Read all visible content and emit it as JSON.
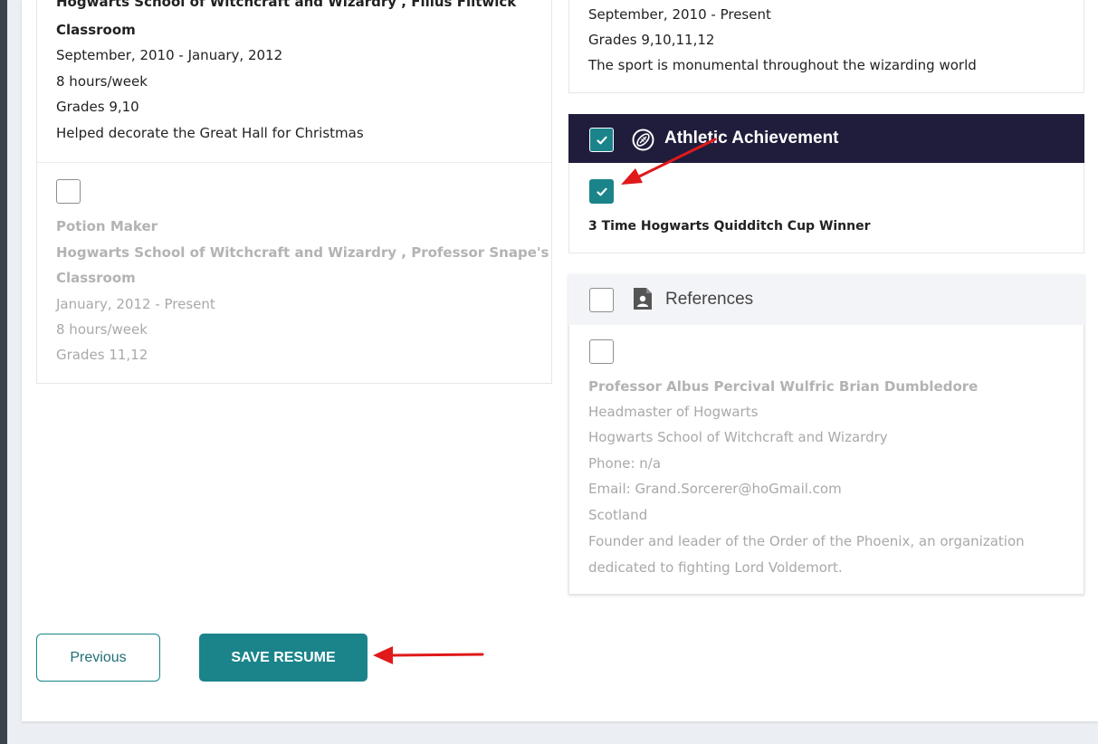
{
  "left_column": {
    "entry1": {
      "org_partial": "Hogwarts School of Witchcraft and Wizardry , Filius Flitwick",
      "org_line2": "Classroom",
      "dates": "September, 2010 - January, 2012",
      "hours": "8 hours/week",
      "grades": "Grades 9,10",
      "description": "Helped decorate the Great Hall for Christmas"
    },
    "entry2": {
      "title": "Potion Maker",
      "org_line1": "Hogwarts School of Witchcraft and Wizardry , Professor Snape's",
      "org_line2": "Classroom",
      "dates": "January, 2012 - Present",
      "hours": "8 hours/week",
      "grades": "Grades 11,12"
    }
  },
  "right_column": {
    "top_entry": {
      "dates": "September, 2010 - Present",
      "grades": "Grades 9,10,11,12",
      "description": "The sport is monumental throughout the wizarding world"
    },
    "athletic": {
      "header": "Athletic Achievement",
      "item": "3 Time Hogwarts Quidditch Cup Winner"
    },
    "references": {
      "header": "References",
      "name": "Professor Albus Percival Wulfric Brian Dumbledore",
      "title": "Headmaster of Hogwarts",
      "org": "Hogwarts School of Witchcraft and Wizardry",
      "phone": "Phone: n/a",
      "email": "Email: Grand.Sorcerer@hoGmail.com",
      "location": "Scotland",
      "desc_line1": "Founder and leader of the Order of the Phoenix, an organization",
      "desc_line2": "dedicated to fighting Lord Voldemort."
    }
  },
  "buttons": {
    "previous": "Previous",
    "save": "SAVE RESUME"
  },
  "colors": {
    "accent": "#1a848a",
    "header_dark": "#1f1d3b",
    "annotation_arrow": "#e0191b"
  }
}
